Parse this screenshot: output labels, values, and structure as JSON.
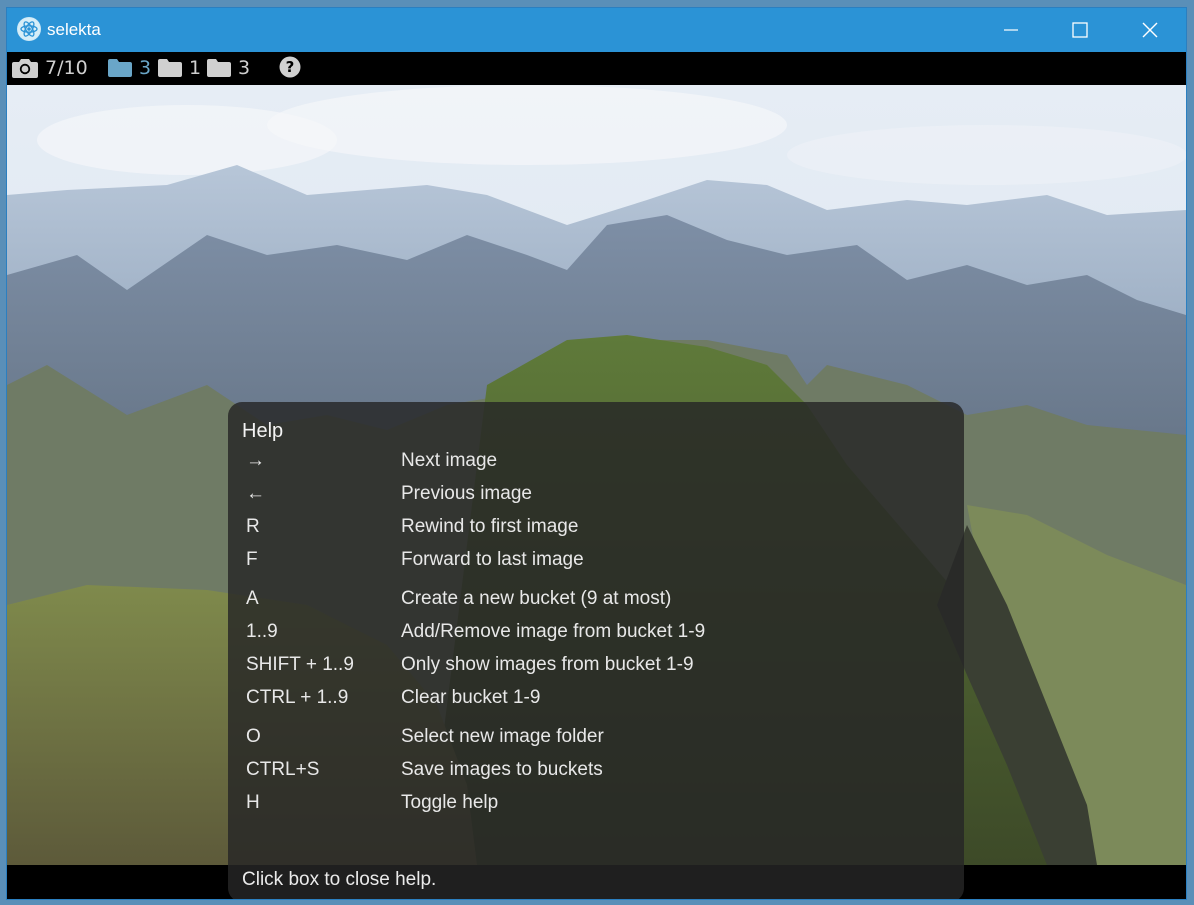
{
  "window": {
    "title": "selekta",
    "controls": [
      "minimize",
      "maximize",
      "close"
    ]
  },
  "toolbar": {
    "image_counter": "7/10",
    "buckets": [
      {
        "count": "3",
        "active": true
      },
      {
        "count": "1",
        "active": false
      },
      {
        "count": "3",
        "active": false
      }
    ],
    "icons": [
      "camera-icon",
      "folder-icon",
      "help-icon"
    ]
  },
  "help": {
    "title": "Help",
    "rows": [
      {
        "key": "→",
        "desc": "Next image"
      },
      {
        "key": "←",
        "desc": "Previous image"
      },
      {
        "key": "R",
        "desc": "Rewind to first image"
      },
      {
        "key": "F",
        "desc": "Forward to last image"
      },
      {
        "key": "A",
        "desc": "Create a new bucket (9 at most)"
      },
      {
        "key": "1..9",
        "desc": "Add/Remove image from bucket 1-9"
      },
      {
        "key": "SHIFT + 1..9",
        "desc": "Only show images from bucket 1-9"
      },
      {
        "key": "CTRL + 1..9",
        "desc": "Clear bucket 1-9"
      },
      {
        "key": "O",
        "desc": "Select new image folder"
      },
      {
        "key": "CTRL+S",
        "desc": "Save images to buckets"
      },
      {
        "key": "H",
        "desc": "Toggle help"
      }
    ],
    "close_hint": "Click box to close help."
  },
  "colors": {
    "titlebar": "#2b93d6",
    "active_bucket": "#6aa6c8",
    "bucket": "#d0d0d0"
  }
}
